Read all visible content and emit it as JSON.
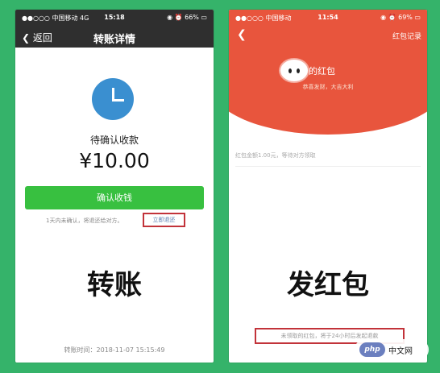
{
  "left_phone": {
    "status_bar": {
      "carrier": "●●○○○ 中国移动 4G",
      "time": "15:18",
      "battery": "◉ ⏰ 66% ▭"
    },
    "nav": {
      "back_label": "返回",
      "back_icon": "chevron-left-icon",
      "title": "转账详情"
    },
    "clock_icon": "clock-icon",
    "status_text": "待确认收款",
    "amount": "¥10.00",
    "confirm_button": "确认收钱",
    "notice": "1天内未确认，将退还给对方。",
    "refund_link": "立即退还",
    "big_label": "转账",
    "transfer_time": "转账时间：2018-11-07 15:15:49",
    "colors": {
      "nav_bg": "#2f2f2f",
      "button": "#38c040",
      "highlight_border": "#c2333a",
      "clock": "#3a8fd0"
    }
  },
  "right_phone": {
    "status_bar": {
      "carrier": "●●○○○ 中国移动",
      "time": "11:54",
      "battery": "◉ ⏰ 69% ▭"
    },
    "nav": {
      "back_icon": "chevron-left-icon",
      "record_label": "红包记录"
    },
    "avatar_icon": "cartoon-face-avatar",
    "title": "的红包",
    "wish": "恭喜发财，大吉大利",
    "info": "红包金额1.00元，等待对方领取",
    "big_label": "发红包",
    "footer": "未领取的红包，将于24小时后发起退款",
    "colors": {
      "header_bg": "#e8553d"
    }
  },
  "watermark": {
    "logo": "php",
    "text": "中文网"
  },
  "colors": {
    "background": "#35b36a"
  }
}
